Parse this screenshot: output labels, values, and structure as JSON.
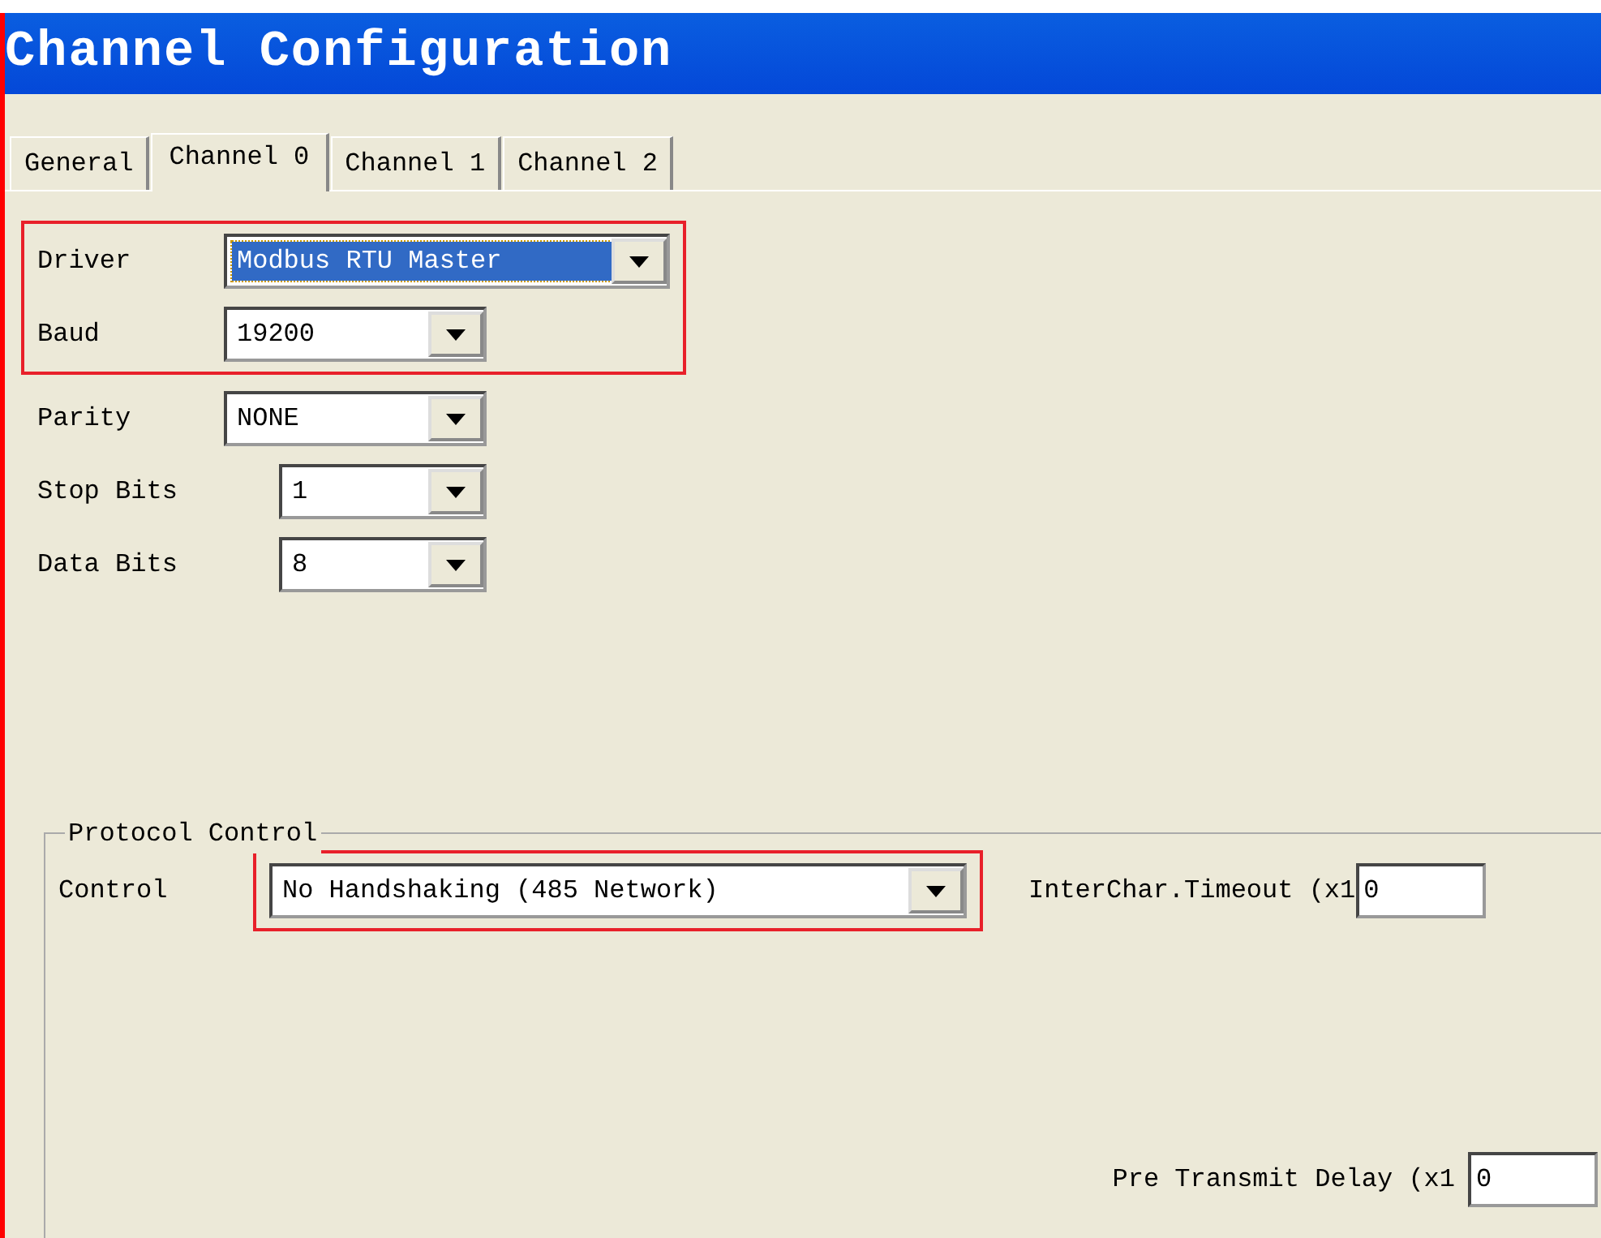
{
  "window": {
    "title": "Channel Configuration"
  },
  "tabs": [
    {
      "label": "General",
      "selected": false
    },
    {
      "label": "Channel 0",
      "selected": true
    },
    {
      "label": "Channel 1",
      "selected": false
    },
    {
      "label": "Channel 2",
      "selected": false
    }
  ],
  "field_groups": [
    {
      "highlighted": true,
      "fields": [
        {
          "label": "Driver",
          "value": "Modbus RTU Master",
          "focused": true
        },
        {
          "label": "Baud",
          "value": "19200",
          "focused": false
        }
      ]
    },
    {
      "highlighted": false,
      "fields": [
        {
          "label": "Parity",
          "value": "NONE",
          "focused": false
        },
        {
          "label": "Stop Bits",
          "value": "1",
          "focused": false
        },
        {
          "label": "Data Bits",
          "value": "8",
          "focused": false
        }
      ]
    }
  ],
  "protocol_control": {
    "title": "Protocol Control",
    "control_label": "Control",
    "control_value": "No Handshaking (485 Network)",
    "highlighted": true,
    "interchar_timeout": {
      "label": "InterChar.Timeout (x1",
      "value": "0"
    },
    "pre_transmit_delay": {
      "label": "Pre Transmit Delay (x1",
      "value": "0"
    }
  }
}
